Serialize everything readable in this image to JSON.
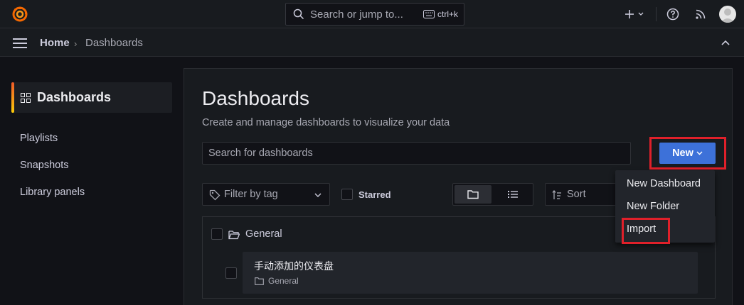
{
  "topbar": {
    "search_placeholder": "Search or jump to...",
    "shortcut": "ctrl+k",
    "icons": [
      "grafana-logo-icon",
      "search-icon",
      "keyboard-icon",
      "plus-icon",
      "help-icon",
      "rss-icon",
      "avatar"
    ]
  },
  "breadcrumb": {
    "home": "Home",
    "separator": "›",
    "current": "Dashboards"
  },
  "sidebar": {
    "active": "Dashboards",
    "items": [
      {
        "label": "Playlists"
      },
      {
        "label": "Snapshots"
      },
      {
        "label": "Library panels"
      }
    ]
  },
  "main": {
    "title": "Dashboards",
    "subtitle": "Create and manage dashboards to visualize your data",
    "search_placeholder": "Search for dashboards",
    "new_button": "New",
    "tag_filter": "Filter by tag",
    "starred_label": "Starred",
    "sort_label": "Sort"
  },
  "folders": [
    {
      "name": "General",
      "dashboards": [
        {
          "title": "手动添加的仪表盘",
          "folder": "General"
        }
      ]
    }
  ],
  "new_menu": {
    "items": [
      "New Dashboard",
      "New Folder",
      "Import"
    ]
  },
  "colors": {
    "accent_blue": "#3d71d9",
    "highlight_red": "#e0202a",
    "background": "#111217",
    "panel": "#181b1f"
  }
}
